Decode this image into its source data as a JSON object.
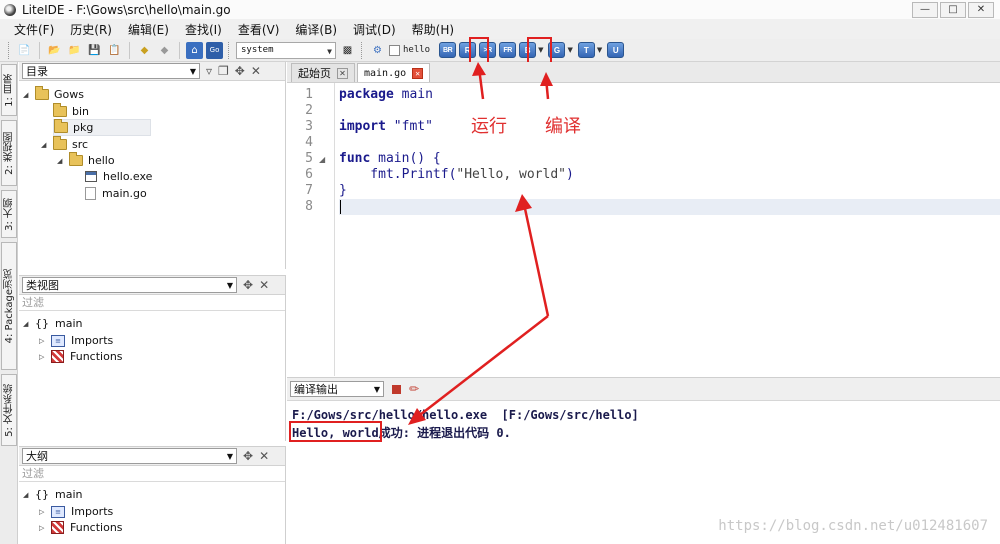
{
  "window": {
    "title": "LiteIDE - F:\\Gows\\src\\hello\\main.go"
  },
  "menu": [
    "文件(F)",
    "历史(R)",
    "编辑(E)",
    "查找(I)",
    "查看(V)",
    "编译(B)",
    "调试(D)",
    "帮助(H)"
  ],
  "toolbar": {
    "env_select": "system",
    "target_label": "hello",
    "build_buttons": [
      "BR",
      "R",
      ">R",
      "FR",
      "B",
      "G",
      "T",
      "U"
    ]
  },
  "left_tabs": [
    "1: 目录",
    "2: 类视图",
    "3: 大纲",
    "4: Package浏览",
    "5: 文件系统"
  ],
  "dir_panel": {
    "title": "目录",
    "tree": [
      "Gows",
      "bin",
      "pkg",
      "src",
      "hello",
      "hello.exe",
      "main.go"
    ]
  },
  "class_panel": {
    "title": "类视图",
    "filter_placeholder": "过滤",
    "tree": [
      "main",
      "Imports",
      "Functions"
    ]
  },
  "outline_panel": {
    "title": "大纲",
    "filter_placeholder": "过滤",
    "tree": [
      "main",
      "Imports",
      "Functions"
    ]
  },
  "editor": {
    "tabs": [
      "起始页",
      "main.go"
    ],
    "line_numbers": [
      "1",
      "2",
      "3",
      "4",
      "5",
      "6",
      "7",
      "8"
    ],
    "code": {
      "l1_kw": "package",
      "l1_rest": " main",
      "l3_kw": "import",
      "l3_rest": " \"fmt\"",
      "l5_kw": "func",
      "l5_rest": " main() {",
      "l6_pre": "    fmt.Printf(",
      "l6_str": "\"Hello, world\"",
      "l6_post": ")",
      "l7": "}"
    }
  },
  "annotations": {
    "run": "运行",
    "build": "编译"
  },
  "output": {
    "select": "编译输出",
    "line1": "F:/Gows/src/hello/hello.exe  [F:/Gows/src/hello]",
    "line2": "Hello, world成功: 进程退出代码 0."
  },
  "watermark": "https://blog.csdn.net/u012481607",
  "colors": {
    "annotation_red": "#e02020",
    "build_button_blue": "#3465b4"
  }
}
